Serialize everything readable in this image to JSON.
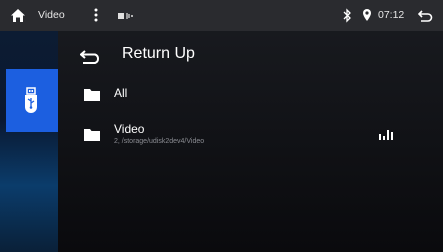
{
  "statusbar": {
    "title": "Video",
    "time": "07:12",
    "icons": {
      "home": "home-icon",
      "menu": "more-vertical-icon",
      "media": "media-indicator-icon",
      "bluetooth": "bluetooth-icon",
      "location": "location-icon",
      "back": "back-icon"
    }
  },
  "sidebar": {
    "items": [
      {
        "icon": "usb-icon",
        "active": true
      }
    ]
  },
  "list": {
    "return_label": "Return Up",
    "items": [
      {
        "name": "All",
        "icon": "folder-icon"
      },
      {
        "name": "Video",
        "path": "2, /storage/udisk2dev4/Video",
        "icon": "folder-icon",
        "playing_icon": "equalizer-icon"
      }
    ]
  },
  "colors": {
    "accent": "#1c5fe0",
    "statusbar_bg": "#2a2b2f",
    "background": "#111216"
  }
}
